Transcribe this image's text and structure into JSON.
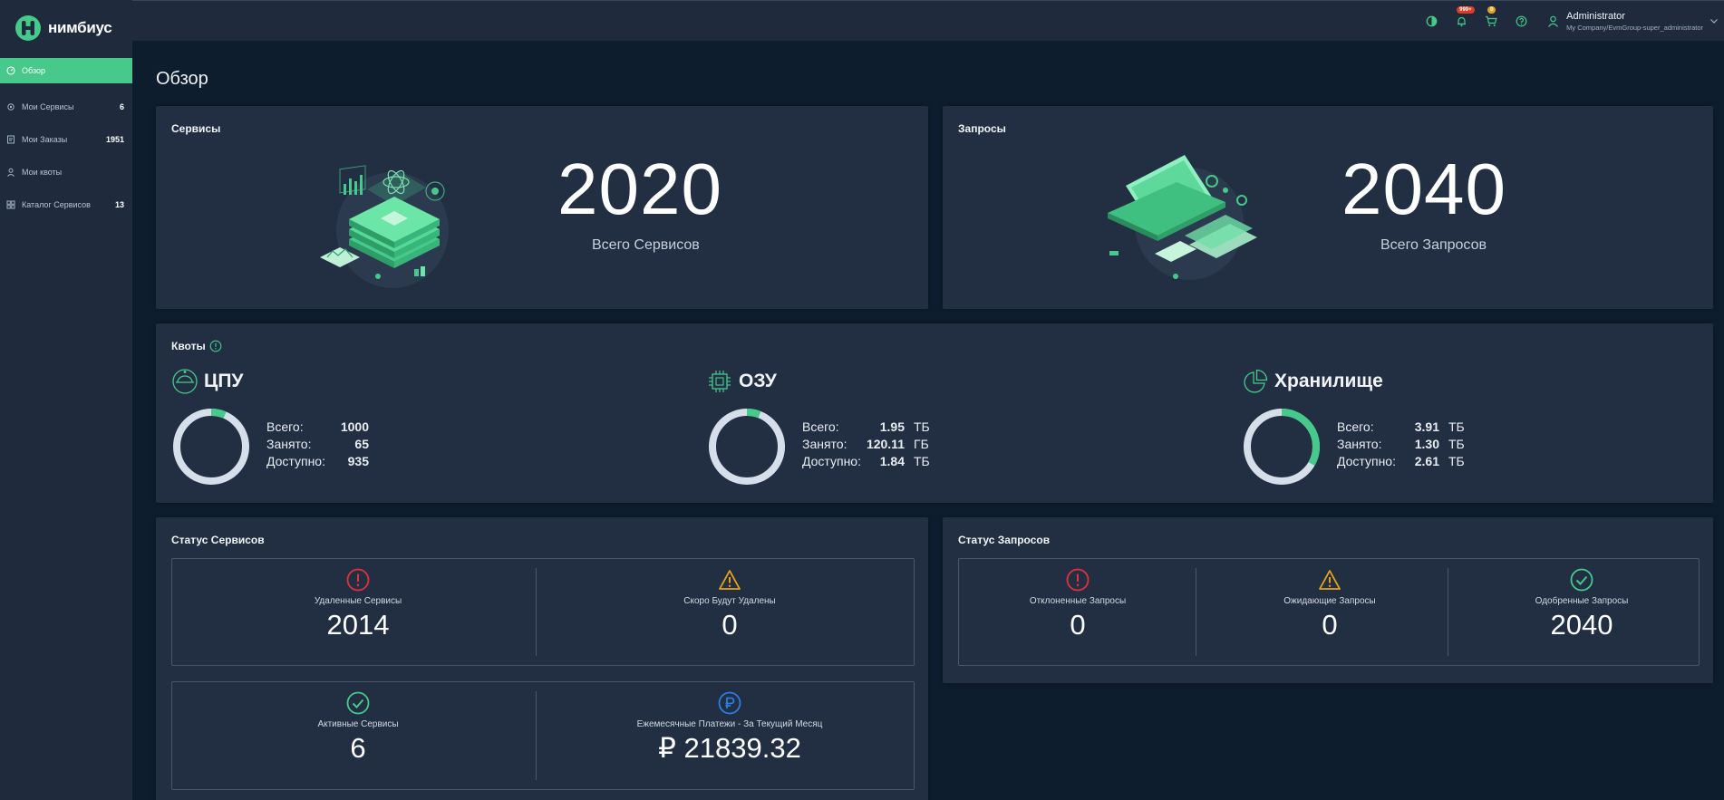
{
  "brand": {
    "name": "нимбиус"
  },
  "sidebar": {
    "items": [
      {
        "label": "Обзор",
        "count": "",
        "icon": "dashboard-icon",
        "active": true
      },
      {
        "label": "Мои Сервисы",
        "count": "6",
        "icon": "gear-icon"
      },
      {
        "label": "Мои Заказы",
        "count": "1951",
        "icon": "orders-icon"
      },
      {
        "label": "Мои квоты",
        "count": "",
        "icon": "user-icon"
      },
      {
        "label": "Каталог Сервисов",
        "count": "13",
        "icon": "catalog-icon"
      }
    ]
  },
  "topbar": {
    "notifications_badge": "999+",
    "cart_badge": "0",
    "user_name": "Administrator",
    "user_org": "My Company/EvmGroup-super_administrator"
  },
  "page": {
    "title": "Обзор"
  },
  "services_card": {
    "title": "Сервисы",
    "value": "2020",
    "label": "Всего Сервисов"
  },
  "requests_card": {
    "title": "Запросы",
    "value": "2040",
    "label": "Всего Запросов"
  },
  "quotas": {
    "title": "Квоты",
    "labels": {
      "total": "Всего:",
      "used": "Занято:",
      "free": "Доступно:"
    },
    "cpu": {
      "title": "ЦПУ",
      "total": "1000",
      "used": "65",
      "free": "935",
      "total_unit": "",
      "used_unit": "",
      "free_unit": "",
      "used_fraction": 0.065
    },
    "ram": {
      "title": "ОЗУ",
      "total": "1.95",
      "used": "120.11",
      "free": "1.84",
      "total_unit": "ТБ",
      "used_unit": "ГБ",
      "free_unit": "ТБ",
      "used_fraction": 0.06
    },
    "storage": {
      "title": "Хранилище",
      "total": "3.91",
      "used": "1.30",
      "free": "2.61",
      "total_unit": "ТБ",
      "used_unit": "ТБ",
      "free_unit": "ТБ",
      "used_fraction": 0.333
    }
  },
  "service_status": {
    "title": "Статус Сервисов",
    "deleted": {
      "label": "Удаленные Сервисы",
      "value": "2014"
    },
    "soon_deleted": {
      "label": "Скоро Будут Удалены",
      "value": "0"
    },
    "active": {
      "label": "Активные Сервисы",
      "value": "6"
    },
    "monthly": {
      "label": "Ежемесячные Платежи - За Текущий Месяц",
      "value": "₽ 21839.32"
    }
  },
  "request_status": {
    "title": "Статус Запросов",
    "rejected": {
      "label": "Отклоненные Запросы",
      "value": "0"
    },
    "pending": {
      "label": "Ожидающие Запросы",
      "value": "0"
    },
    "approved": {
      "label": "Одобренные Запросы",
      "value": "2040"
    }
  },
  "colors": {
    "accent": "#46c98a",
    "danger": "#e0313c",
    "warning": "#e6a21a",
    "info": "#2a7de1",
    "donut_track": "#d6dfe9"
  }
}
